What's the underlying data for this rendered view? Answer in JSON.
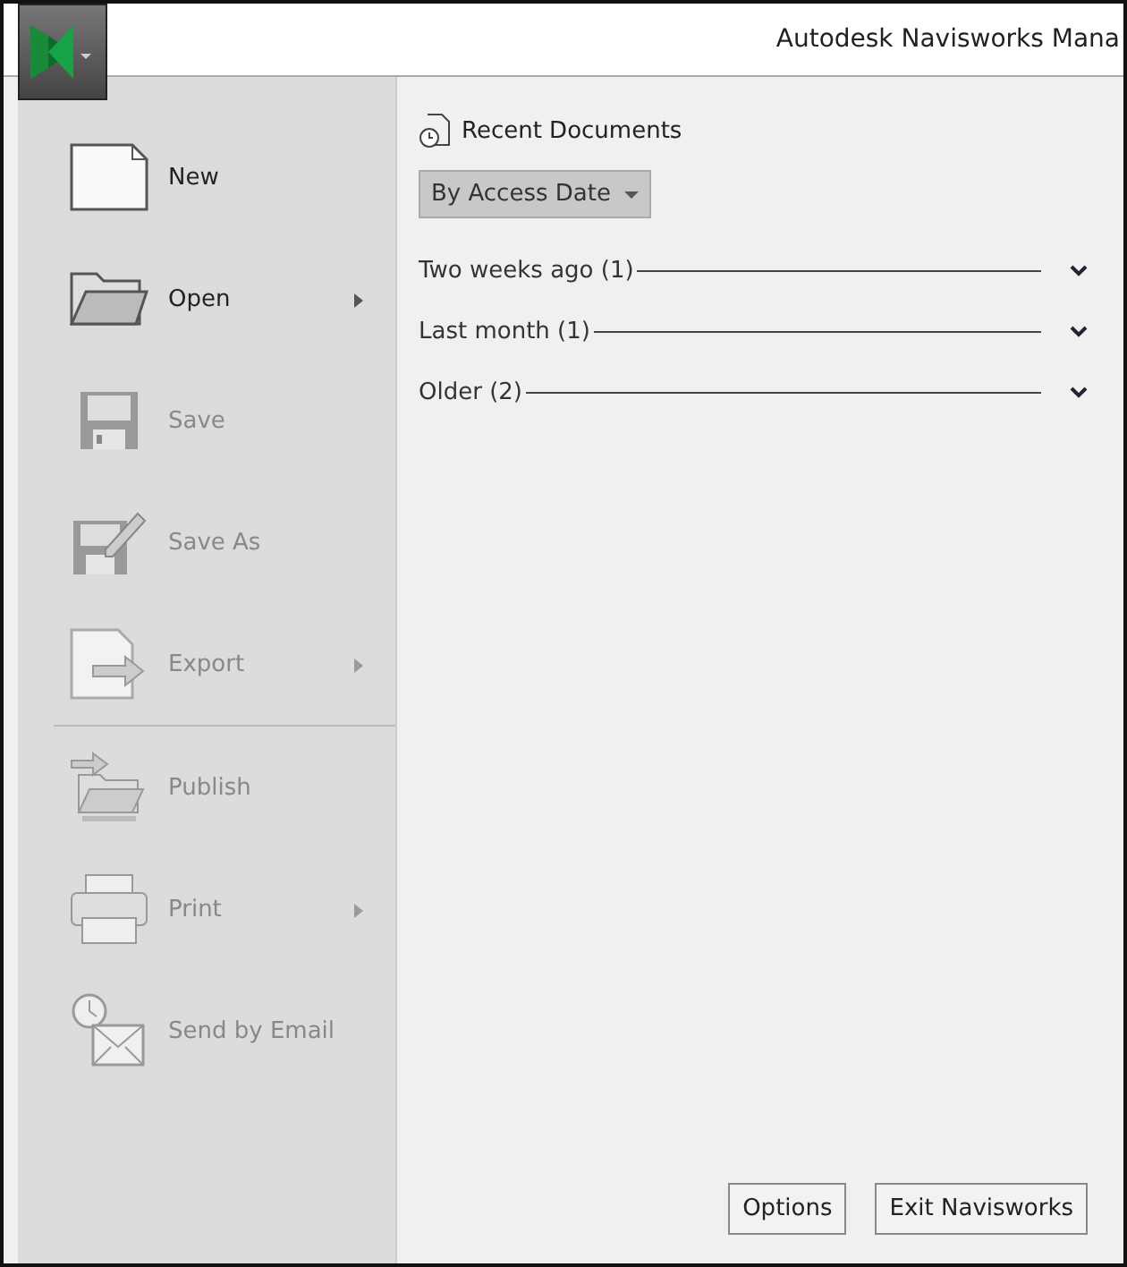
{
  "window": {
    "title": "Autodesk Navisworks Mana"
  },
  "menu": [
    {
      "kind": "new",
      "label": "New",
      "disabled": false,
      "submenu": false
    },
    {
      "kind": "open",
      "label": "Open",
      "disabled": false,
      "submenu": true
    },
    {
      "kind": "save",
      "label": "Save",
      "disabled": true,
      "submenu": false
    },
    {
      "kind": "saveas",
      "label": "Save As",
      "disabled": true,
      "submenu": false
    },
    {
      "kind": "export",
      "label": "Export",
      "disabled": true,
      "submenu": true
    },
    {
      "kind": "divider"
    },
    {
      "kind": "publish",
      "label": "Publish",
      "disabled": true,
      "submenu": false
    },
    {
      "kind": "print",
      "label": "Print",
      "disabled": true,
      "submenu": true
    },
    {
      "kind": "email",
      "label": "Send by Email",
      "disabled": true,
      "submenu": false
    }
  ],
  "recent": {
    "title": "Recent Documents",
    "sort": "By Access Date",
    "groups": [
      {
        "label": "Two weeks ago (1)",
        "expanded": false
      },
      {
        "label": "Last month (1)",
        "expanded": false
      },
      {
        "label": "Older (2)",
        "expanded": false
      }
    ]
  },
  "buttons": [
    "Options",
    "Exit Navisworks"
  ]
}
